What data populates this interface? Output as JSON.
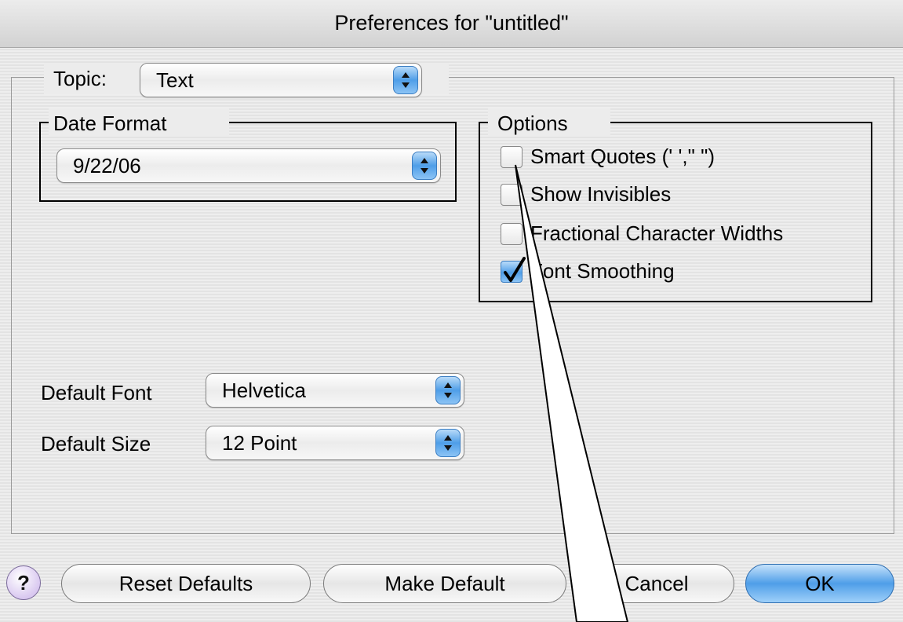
{
  "window": {
    "title": "Preferences for \"untitled\""
  },
  "topic": {
    "label": "Topic:",
    "value": "Text"
  },
  "date_format": {
    "label": "Date Format",
    "value": "9/22/06"
  },
  "options": {
    "label": "Options",
    "items": [
      {
        "label": "Smart Quotes (' ',\" \")",
        "checked": false
      },
      {
        "label": "Show Invisibles",
        "checked": false
      },
      {
        "label": "Fractional Character Widths",
        "checked": false
      },
      {
        "label": "Font Smoothing",
        "checked": true
      }
    ]
  },
  "default_font": {
    "label": "Default Font",
    "value": "Helvetica"
  },
  "default_size": {
    "label": "Default Size",
    "value": "12 Point"
  },
  "buttons": {
    "help": "?",
    "reset_defaults": "Reset Defaults",
    "make_default": "Make Default",
    "cancel": "Cancel",
    "ok": "OK"
  },
  "colors": {
    "accent": "#4f9ee8",
    "checkbox_checked": "#4f9ee8"
  }
}
